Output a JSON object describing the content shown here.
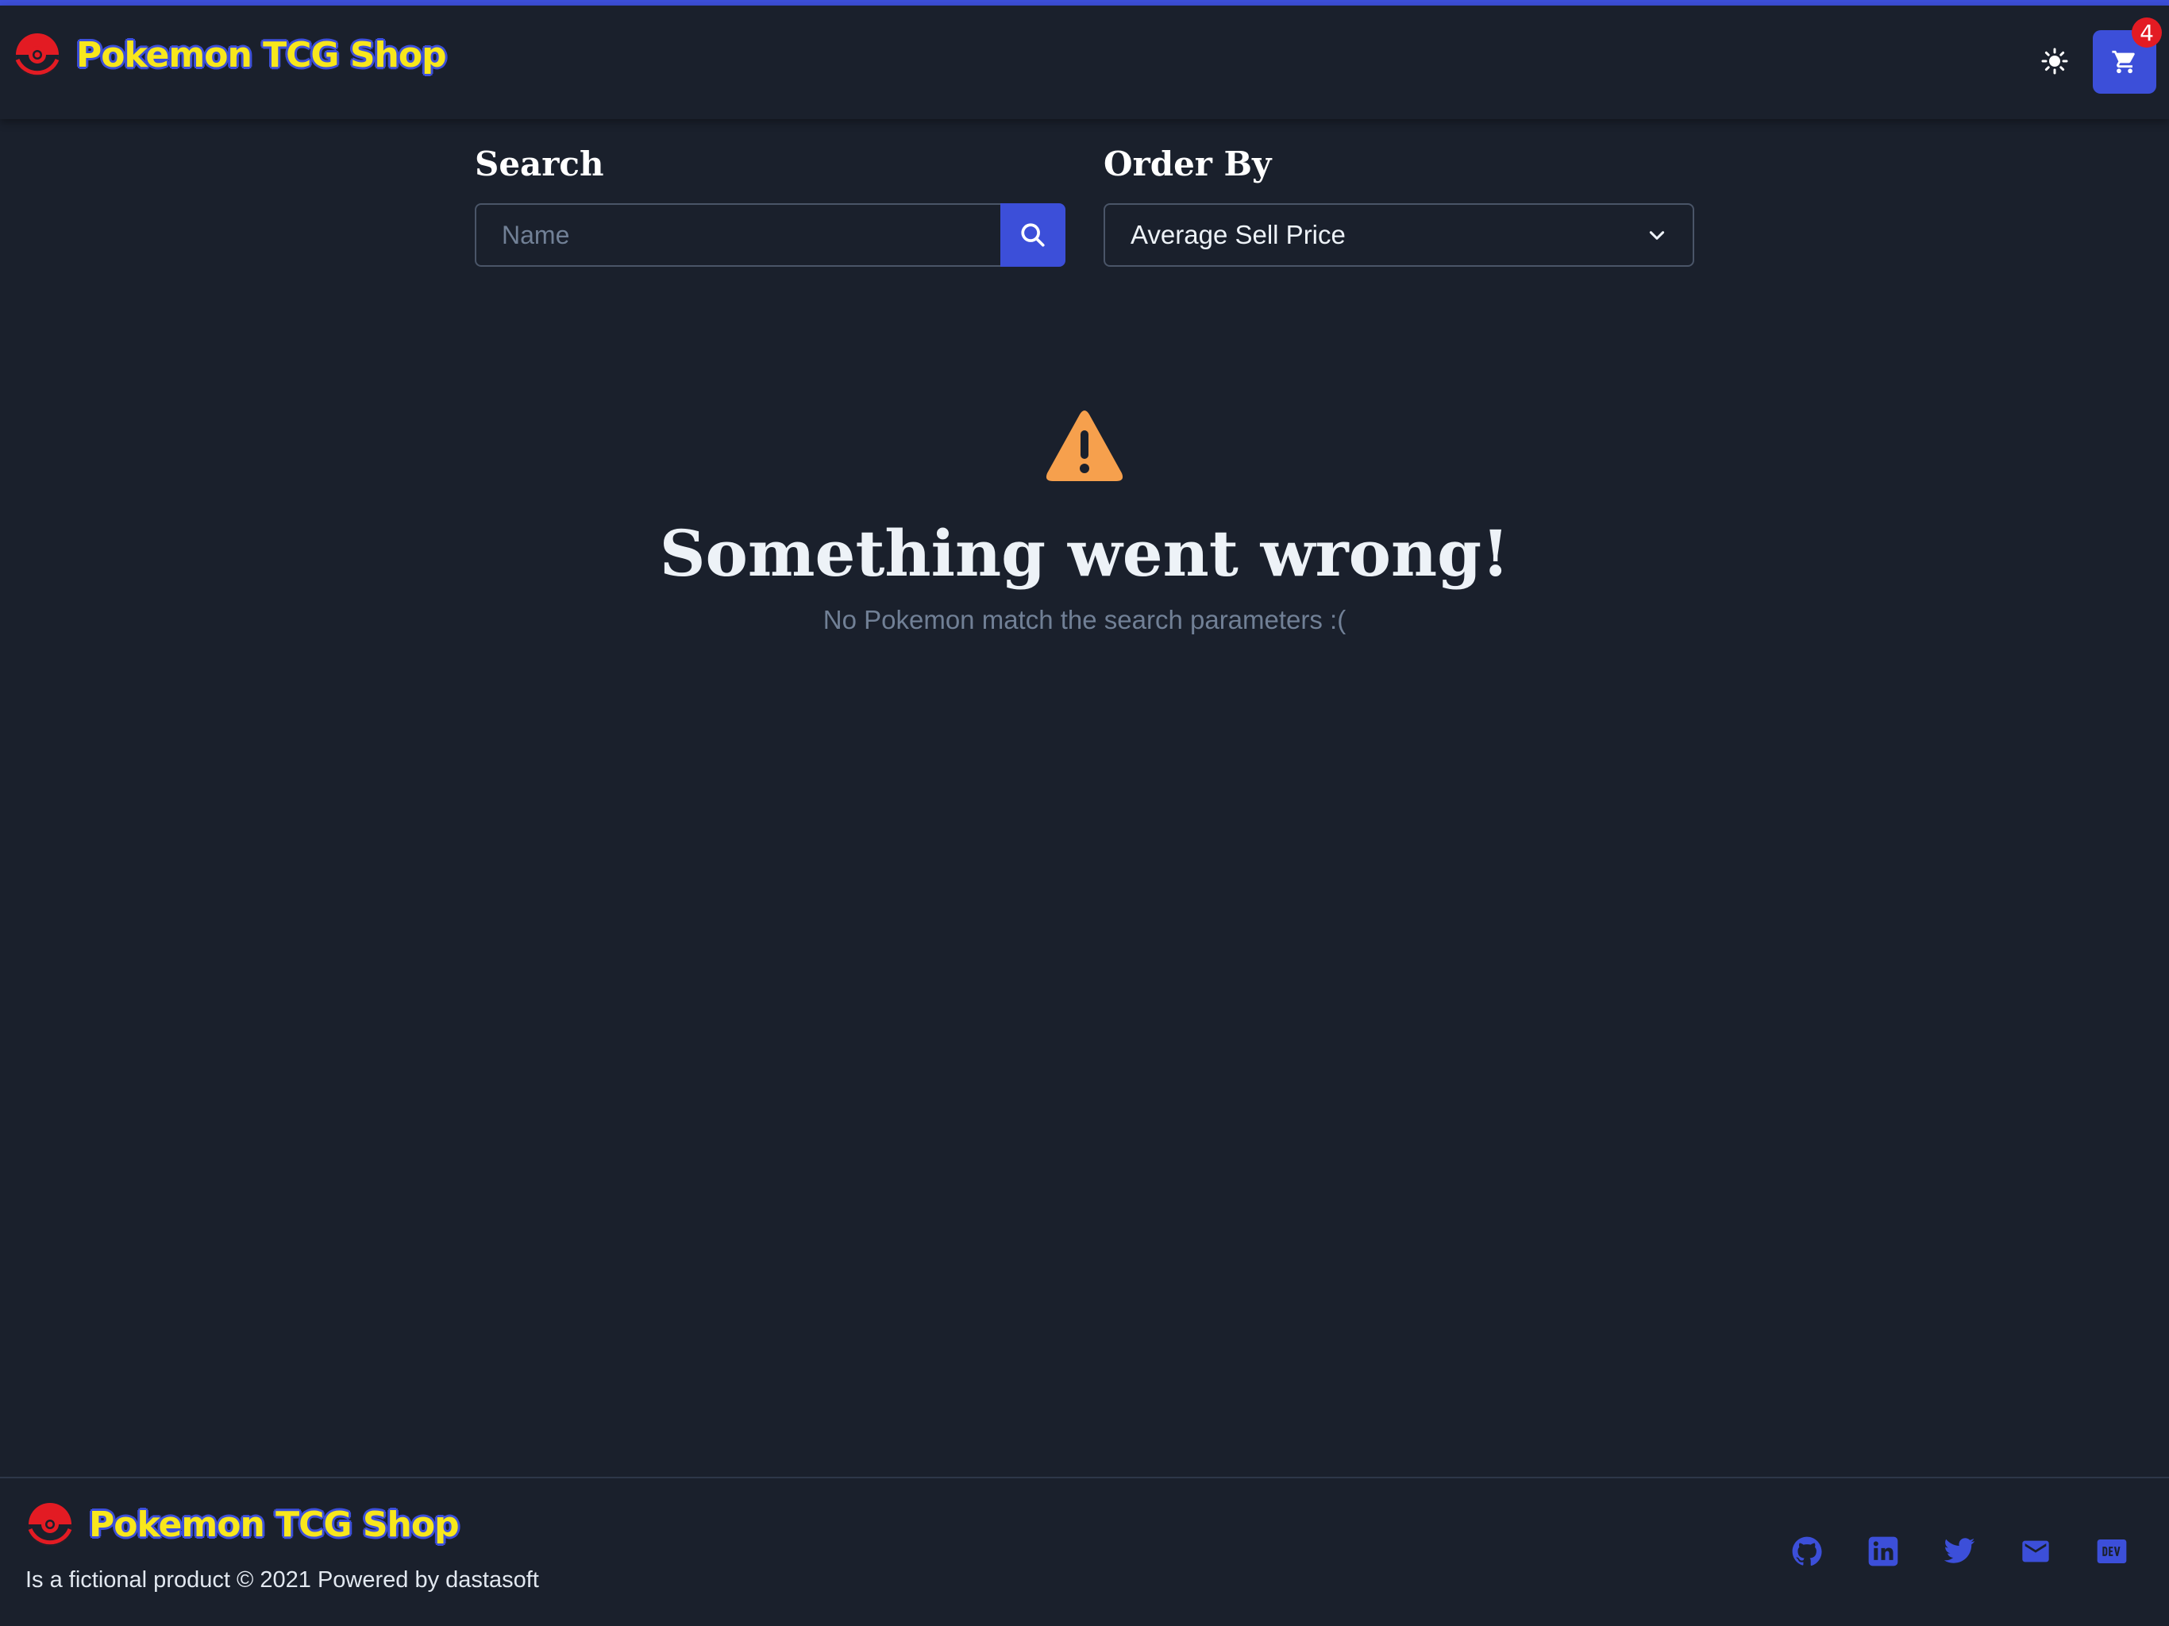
{
  "header": {
    "brand": "Pokemon TCG Shop",
    "theme_icon": "sun-icon",
    "cart_icon": "cart-icon",
    "cart_count": "4"
  },
  "filters": {
    "search_label": "Search",
    "search_placeholder": "Name",
    "search_value": "",
    "order_label": "Order By",
    "order_value": "Average Sell Price"
  },
  "error": {
    "icon": "warning-icon",
    "title": "Something went wrong!",
    "message": "No Pokemon match the search parameters :("
  },
  "footer": {
    "brand": "Pokemon TCG Shop",
    "copyright": "Is a fictional product © 2021 Powered by dastasoft",
    "social_icons": [
      "github-icon",
      "linkedin-icon",
      "twitter-icon",
      "mail-icon",
      "dev-icon"
    ]
  },
  "colors": {
    "background": "#1a202c",
    "accent": "#3c4fd9",
    "brand_yellow": "#f8e71c",
    "badge_red": "#e31b23",
    "warning": "#f6a04d",
    "muted_text": "#718096"
  }
}
